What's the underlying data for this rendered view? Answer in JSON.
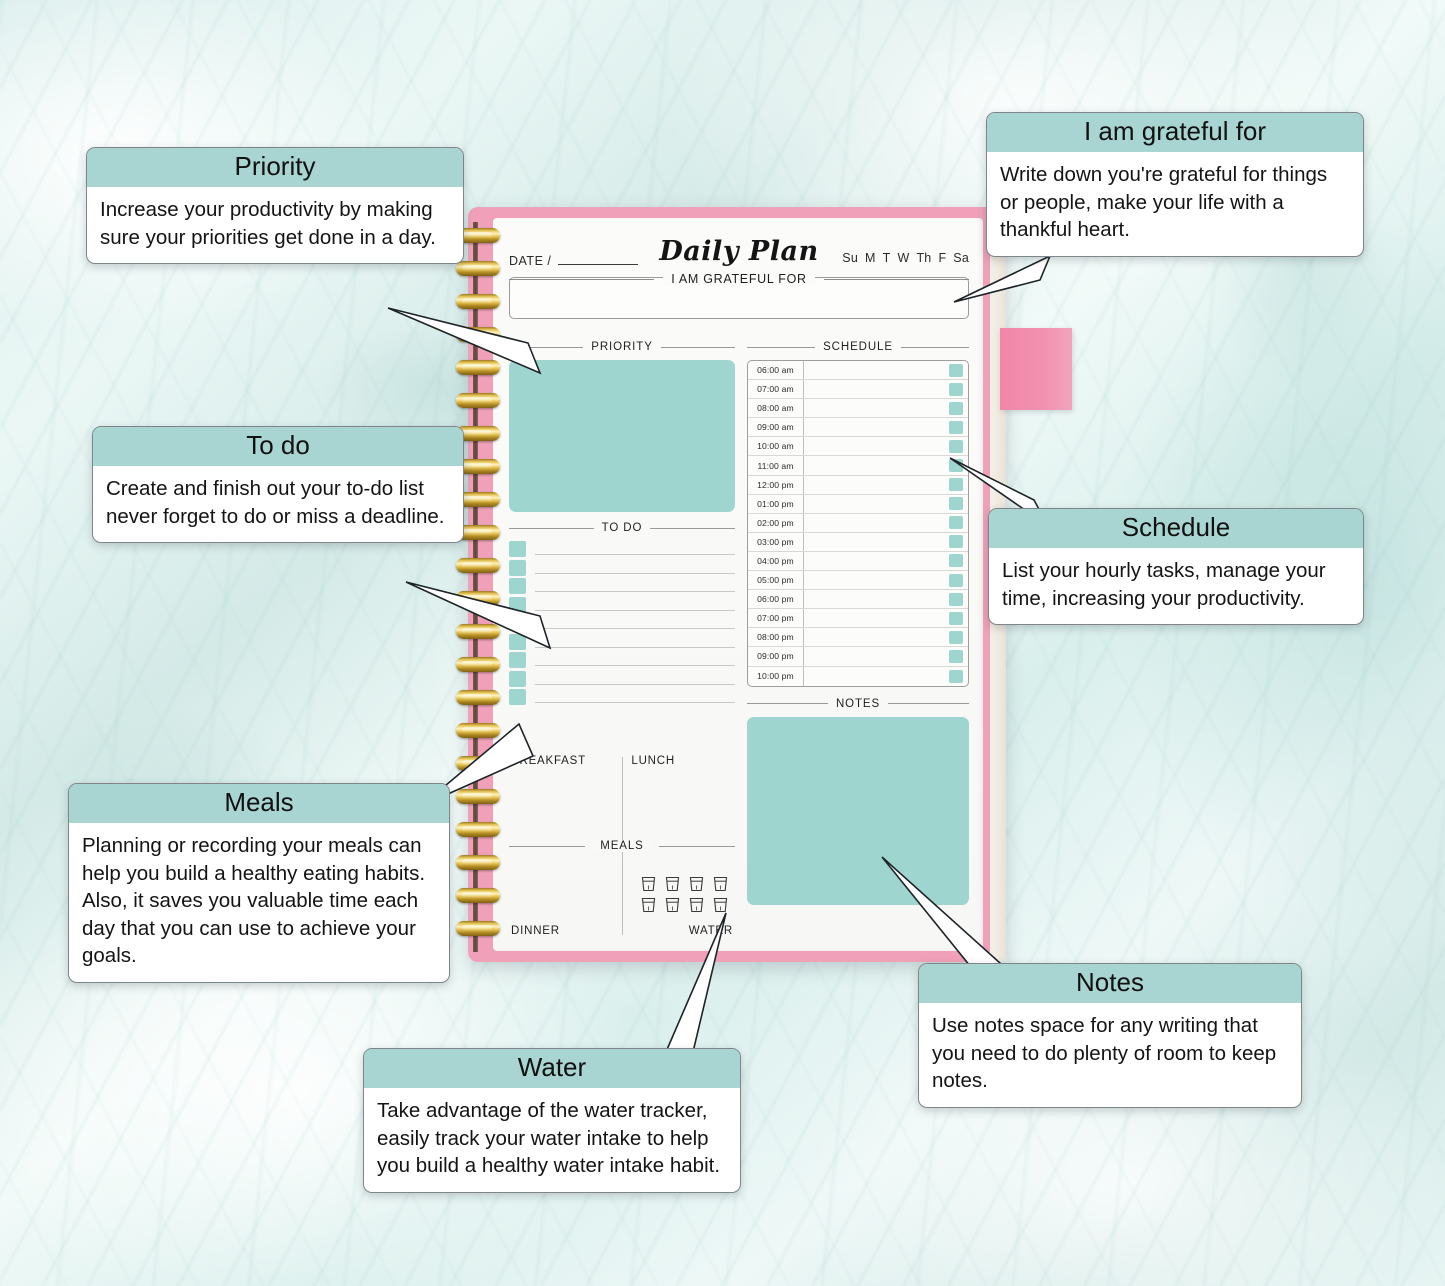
{
  "planner": {
    "date_label": "DATE /",
    "title": "Daily Plan",
    "days": [
      "Su",
      "M",
      "T",
      "W",
      "Th",
      "F",
      "Sa"
    ],
    "grateful_heading": "I AM GRATEFUL FOR",
    "priority_heading": "PRIORITY",
    "todo_heading": "TO DO",
    "schedule_heading": "SCHEDULE",
    "notes_heading": "NOTES",
    "meals_heading": "MEALS",
    "meal_labels": {
      "breakfast": "BREAKFAST",
      "lunch": "LUNCH",
      "dinner": "DINNER",
      "water": "WATER"
    },
    "todo_rows": 9,
    "water_glasses": 8,
    "schedule_times": [
      "06:00 am",
      "07:00 am",
      "08:00 am",
      "09:00 am",
      "10:00 am",
      "11:00 am",
      "12:00 pm",
      "01:00 pm",
      "02:00 pm",
      "03:00 pm",
      "04:00 pm",
      "05:00 pm",
      "06:00 pm",
      "07:00 pm",
      "08:00 pm",
      "09:00 pm",
      "10:00 pm"
    ]
  },
  "callouts": [
    {
      "key": "priority",
      "title": "Priority",
      "body": "Increase your productivity by making sure your priorities get done in a day."
    },
    {
      "key": "grateful",
      "title": "I am grateful for",
      "body": "Write down you're grateful for things or people, make your life with a thankful heart."
    },
    {
      "key": "todo",
      "title": "To do",
      "body": "Create and finish out your to-do list never forget to do or miss a deadline."
    },
    {
      "key": "schedule",
      "title": "Schedule",
      "body": "List your hourly tasks, manage your time, increasing your productivity."
    },
    {
      "key": "meals",
      "title": "Meals",
      "body": "Planning or recording your meals can help you build a healthy eating habits. Also, it saves you valuable time each day that you can use to achieve your goals."
    },
    {
      "key": "notes",
      "title": "Notes",
      "body": "Use notes space for any writing that you need to do plenty of room to keep notes."
    },
    {
      "key": "water",
      "title": "Water",
      "body": "Take advantage of the water tracker, easily track your water intake to help you build a healthy water intake habit."
    }
  ],
  "colors": {
    "teal_block": "#9ed5ce",
    "callout_header": "#a8d5d2",
    "cover_pink": "#f0a0b8",
    "bookmark_pink": "#f391b0",
    "background": "#dcefed"
  }
}
